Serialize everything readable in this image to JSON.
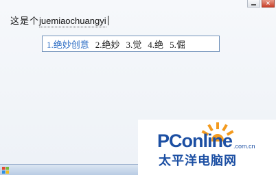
{
  "window": {
    "minimize_icon": "minimize-icon",
    "close_icon": "close-icon",
    "close_glyph": "×"
  },
  "ime": {
    "prefix_text": "这是个",
    "composing_pinyin": "juemiaochuangyi",
    "candidates": [
      {
        "number": "1.",
        "text": "绝妙创意",
        "selected": true
      },
      {
        "number": "2.",
        "text": "绝妙",
        "selected": false
      },
      {
        "number": "3.",
        "text": "觉",
        "selected": false
      },
      {
        "number": "4.",
        "text": "绝",
        "selected": false
      },
      {
        "number": "5.",
        "text": "倔",
        "selected": false
      }
    ],
    "selected_color": "#2b6cc4"
  },
  "taskbar": {
    "start_icon": "windows-start-icon"
  },
  "watermark": {
    "logo_pc": "PC",
    "logo_online": "online",
    "domain": ".com.cn",
    "chinese_name": "太平洋电脑网",
    "brand_color": "#1c4fa3",
    "accent_color": "#f39a1e"
  }
}
